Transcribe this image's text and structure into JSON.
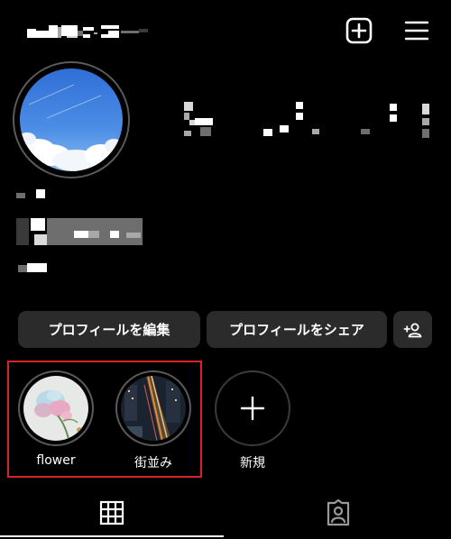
{
  "header": {
    "create_icon": "plus-square-icon",
    "menu_icon": "hamburger-menu-icon"
  },
  "actions": {
    "edit_profile": "プロフィールを編集",
    "share_profile": "プロフィールをシェア",
    "discover_people_icon": "add-person-icon"
  },
  "highlights": [
    {
      "label": "flower"
    },
    {
      "label": "街並み"
    }
  ],
  "new_highlight": {
    "label": "新規",
    "icon": "plus-icon"
  },
  "tabs": [
    {
      "name": "posts-grid",
      "icon": "grid-icon",
      "active": true
    },
    {
      "name": "tagged",
      "icon": "person-tag-icon",
      "active": false
    }
  ],
  "colors": {
    "background": "#000000",
    "button_bg": "#2b2b2b",
    "highlight_frame": "#d8232a"
  }
}
